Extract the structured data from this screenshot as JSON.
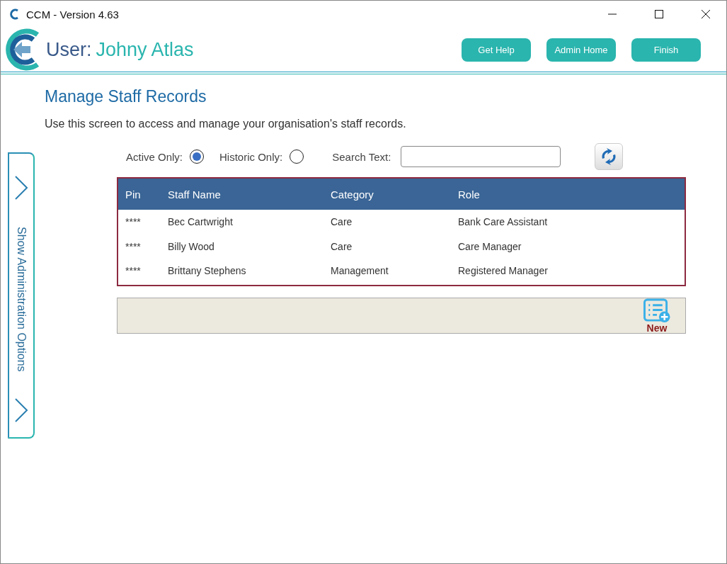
{
  "window": {
    "title": "CCM - Version 4.63"
  },
  "header": {
    "user_label": "User:",
    "user_name": "Johny Atlas",
    "buttons": [
      "Get Help",
      "Admin Home",
      "Finish"
    ]
  },
  "page": {
    "title": "Manage Staff Records",
    "description": "Use this screen to access and manage your organisation's staff records."
  },
  "side_panel": {
    "label": "Show Administration Options"
  },
  "filters": {
    "options": [
      {
        "label": "Active Only:",
        "selected": true
      },
      {
        "label": "Historic Only:",
        "selected": false
      }
    ],
    "search_label": "Search Text:"
  },
  "table": {
    "columns": [
      "Pin",
      "Staff Name",
      "Category",
      "Role"
    ],
    "rows": [
      [
        "****",
        "Bec Cartwright",
        "Care",
        "Bank Care Assistant"
      ],
      [
        "****",
        "Billy Wood",
        "Care",
        "Care Manager"
      ],
      [
        "****",
        "Brittany Stephens",
        "Management",
        "Registered Manager"
      ]
    ]
  },
  "footer": {
    "new_label": "New"
  }
}
